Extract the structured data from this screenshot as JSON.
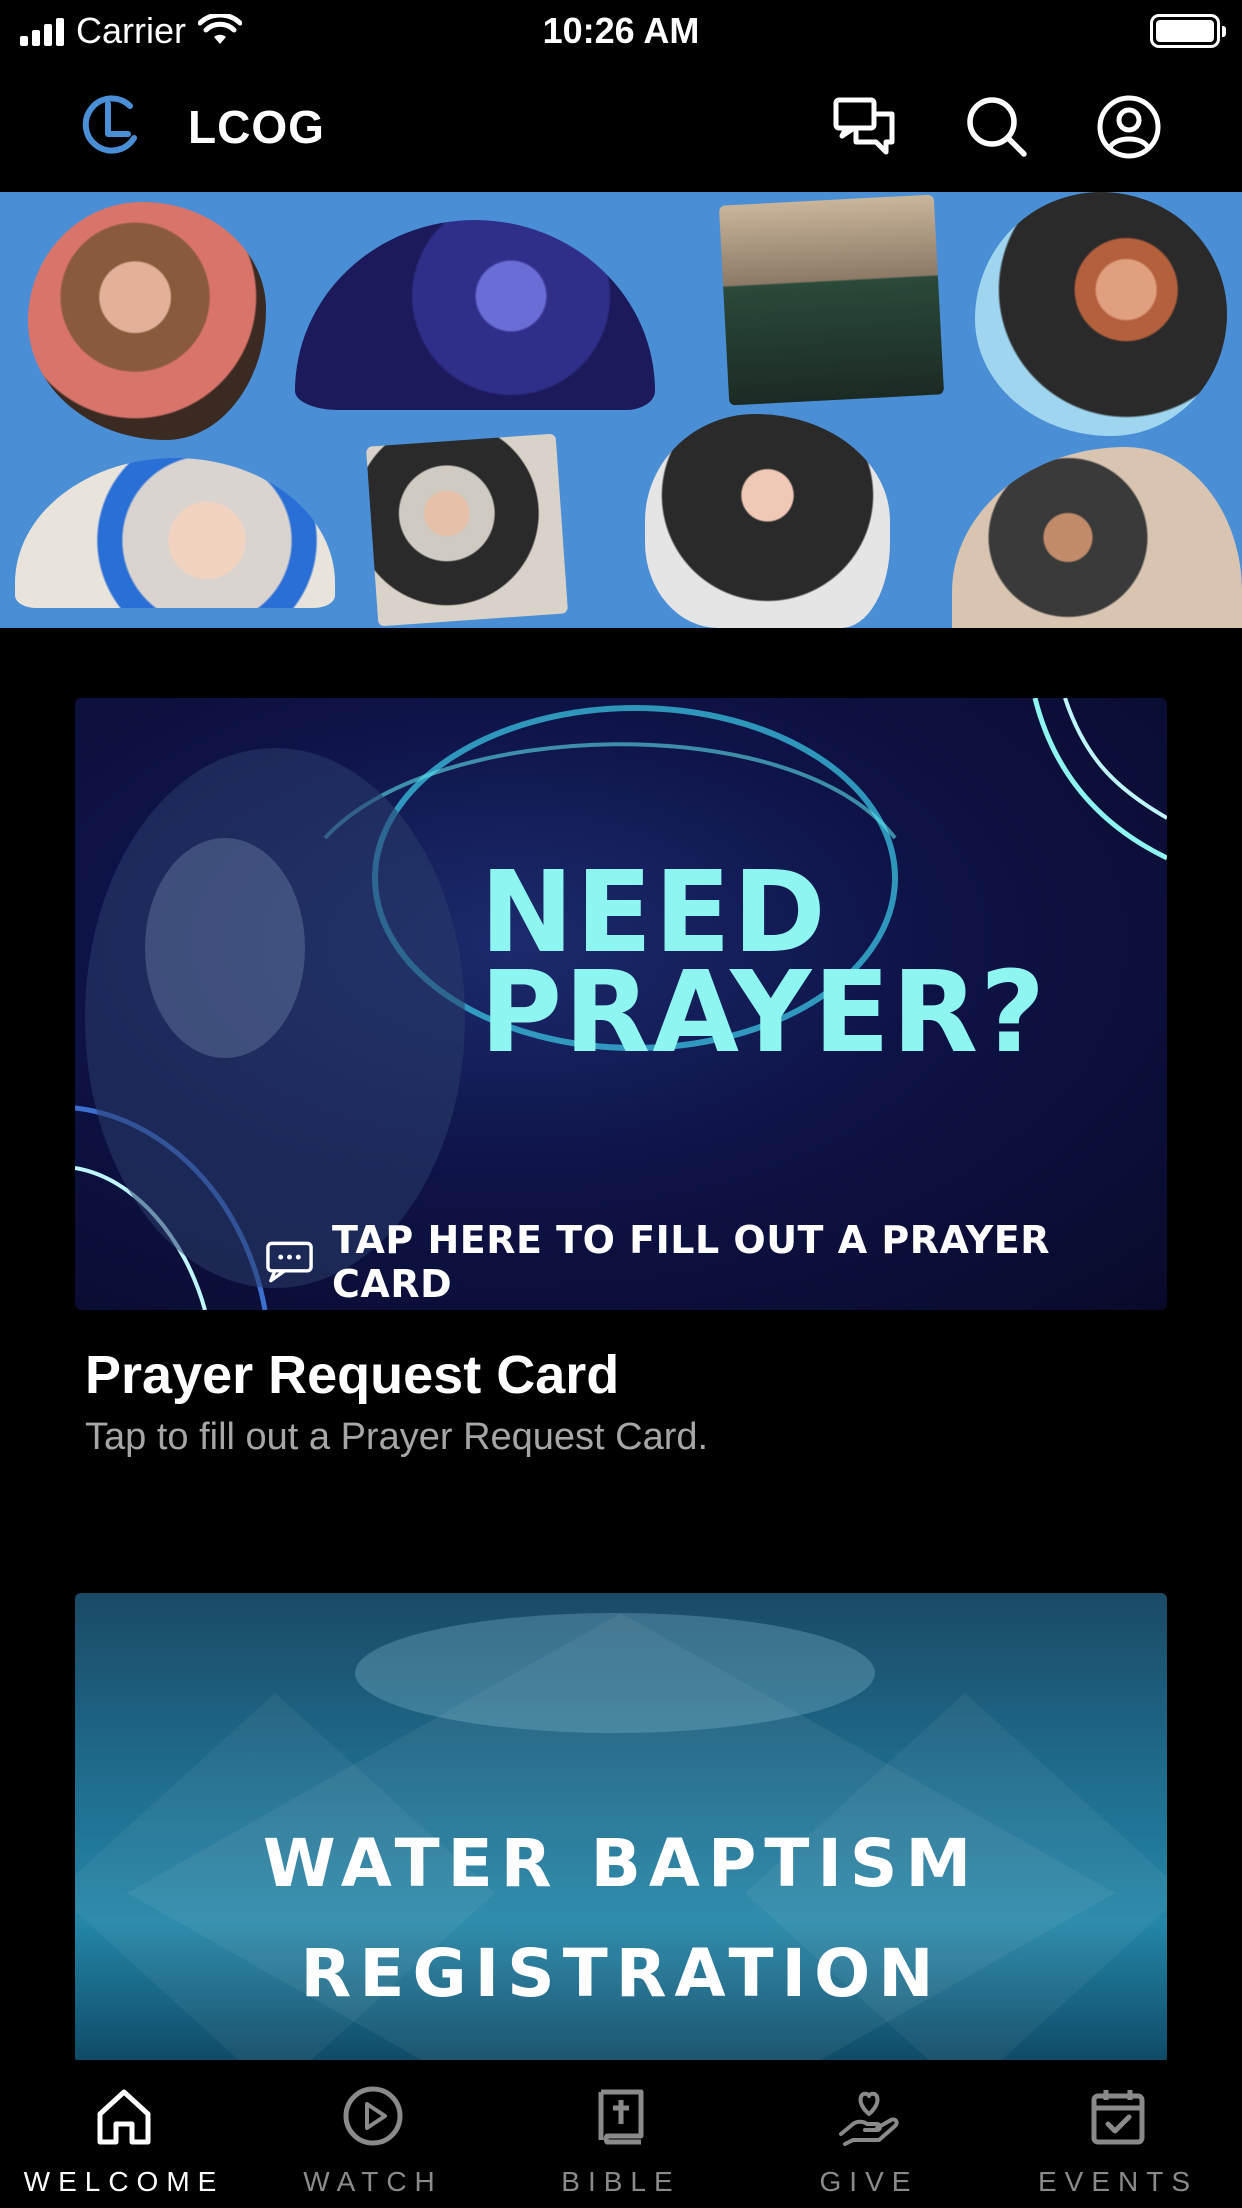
{
  "status_bar": {
    "carrier": "Carrier",
    "time": "10:26 AM"
  },
  "header": {
    "app_title": "LCOG",
    "icons": [
      "chat-icon",
      "search-icon",
      "profile-icon"
    ]
  },
  "hero": {
    "description_icon": "photo-collage"
  },
  "cards": [
    {
      "image_heading_line1": "NEED",
      "image_heading_line2": "PRAYER?",
      "image_cta": "TAP HERE TO FILL OUT A PRAYER CARD",
      "title": "Prayer Request Card",
      "subtitle": "Tap to fill out a Prayer Request Card."
    },
    {
      "image_line1": "WATER BAPTISM",
      "image_line2": "REGISTRATION"
    }
  ],
  "tabs": [
    {
      "label": "WELCOME",
      "icon": "home-icon",
      "active": true
    },
    {
      "label": "WATCH",
      "icon": "play-icon",
      "active": false
    },
    {
      "label": "BIBLE",
      "icon": "bible-icon",
      "active": false
    },
    {
      "label": "GIVE",
      "icon": "give-icon",
      "active": false
    },
    {
      "label": "EVENTS",
      "icon": "calendar-icon",
      "active": false
    }
  ],
  "colors": {
    "background": "#000000",
    "hero_blue": "#4a8fd6",
    "prayer_accent": "#8ff5f0",
    "logo_blue": "#4a8fd6",
    "tab_inactive": "#8a8a8a"
  }
}
